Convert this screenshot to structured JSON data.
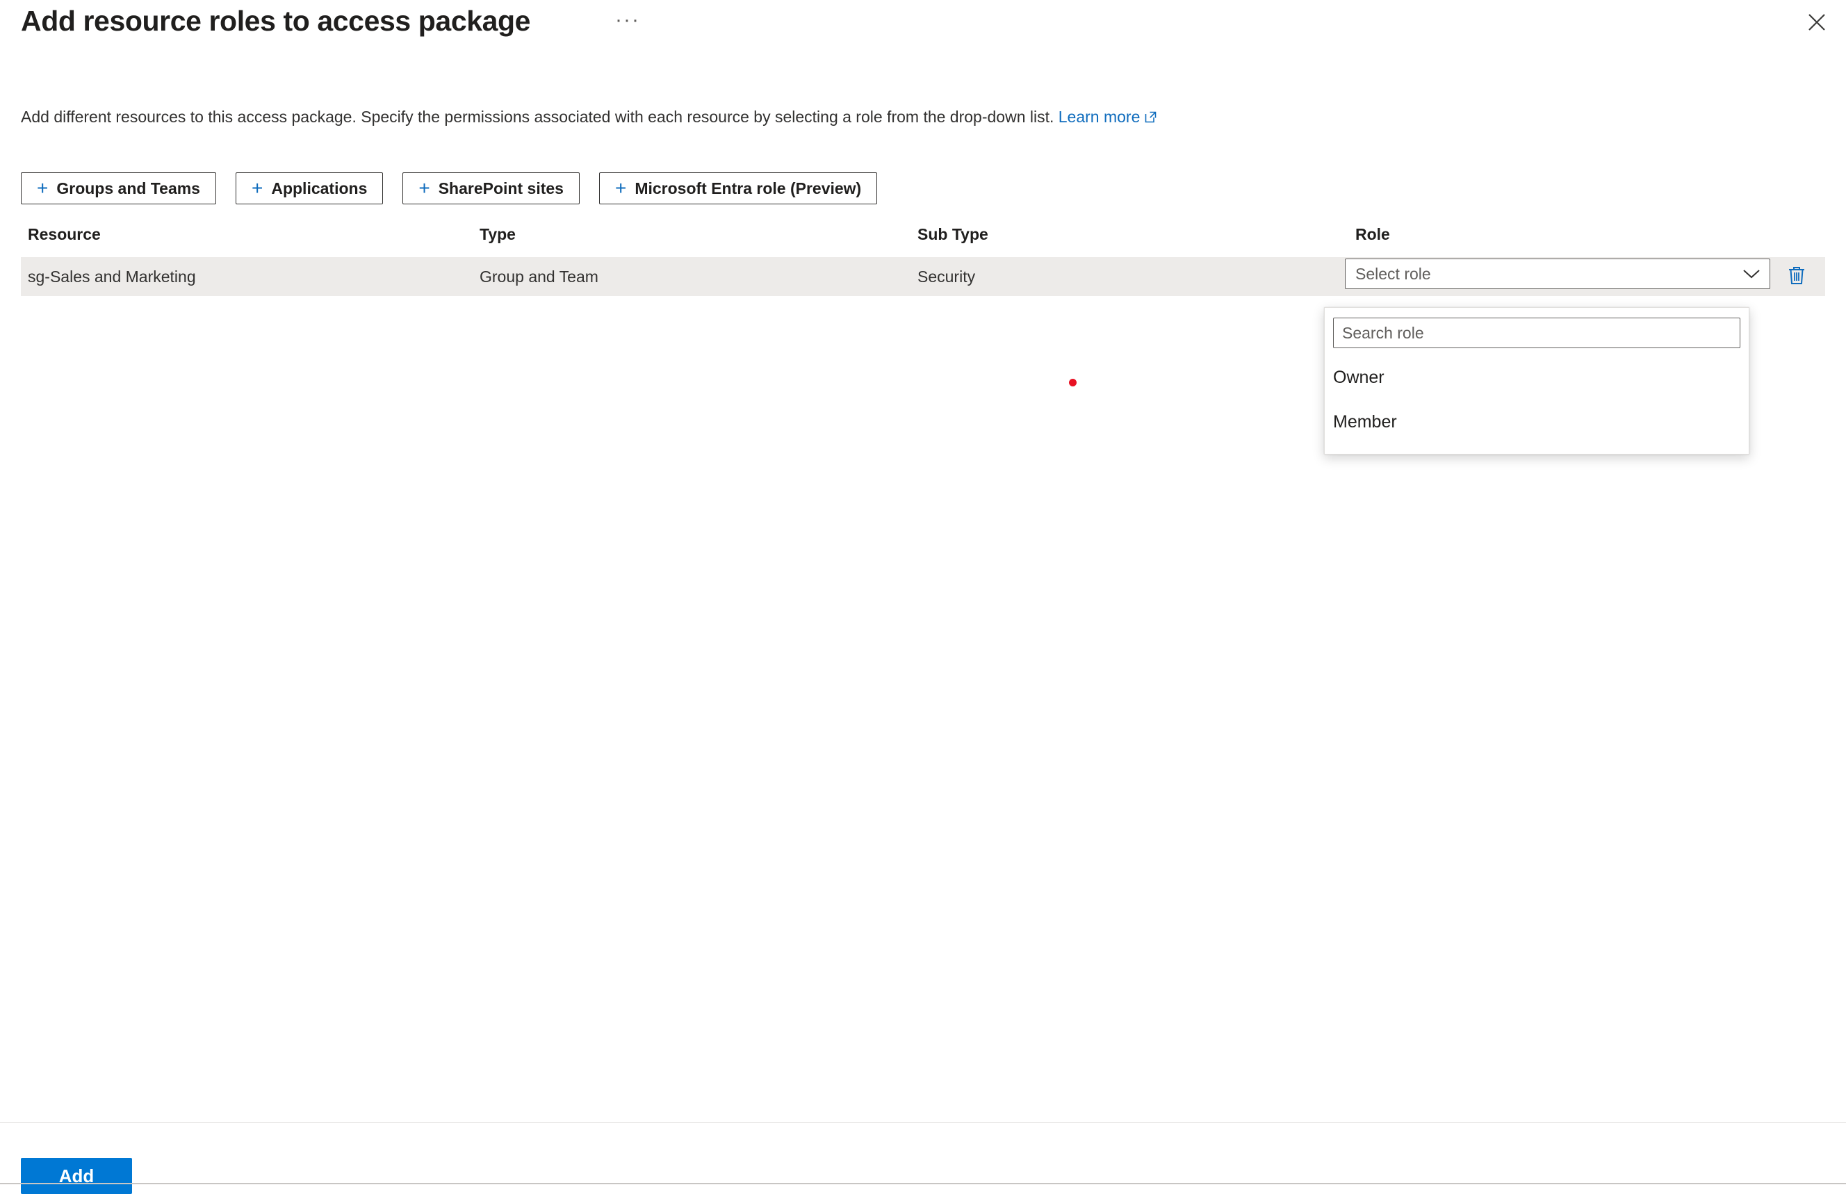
{
  "header": {
    "title": "Add resource roles to access package",
    "context_menu_label": "···",
    "close_label": "Close"
  },
  "description": {
    "text": "Add different resources to this access package. Specify the permissions associated with each resource by selecting a role from the drop-down list.",
    "link_label": "Learn more",
    "link_icon": "external-link-icon"
  },
  "command_bar": {
    "buttons": [
      {
        "label": "Groups and Teams",
        "icon": "plus-icon"
      },
      {
        "label": "Applications",
        "icon": "plus-icon"
      },
      {
        "label": "SharePoint sites",
        "icon": "plus-icon"
      },
      {
        "label": "Microsoft Entra role (Preview)",
        "icon": "plus-icon"
      }
    ]
  },
  "table": {
    "columns": [
      "Resource",
      "Type",
      "Sub Type",
      "Role"
    ],
    "rows": [
      {
        "resource": "sg-Sales and Marketing",
        "type": "Group and Team",
        "sub_type": "Security",
        "role_placeholder": "Select role",
        "delete_icon": "trash-icon",
        "caret_icon": "chevron-down-icon"
      }
    ]
  },
  "role_dropdown": {
    "open": true,
    "search_placeholder": "Search role",
    "search_value": "",
    "options": [
      "Owner",
      "Member"
    ]
  },
  "footer": {
    "primary_button": "Add"
  },
  "colors": {
    "accent": "#0078d4",
    "link": "#0f6cbd",
    "row_background": "#edebe9",
    "text": "#323130",
    "cursor_dot": "#e81123"
  }
}
